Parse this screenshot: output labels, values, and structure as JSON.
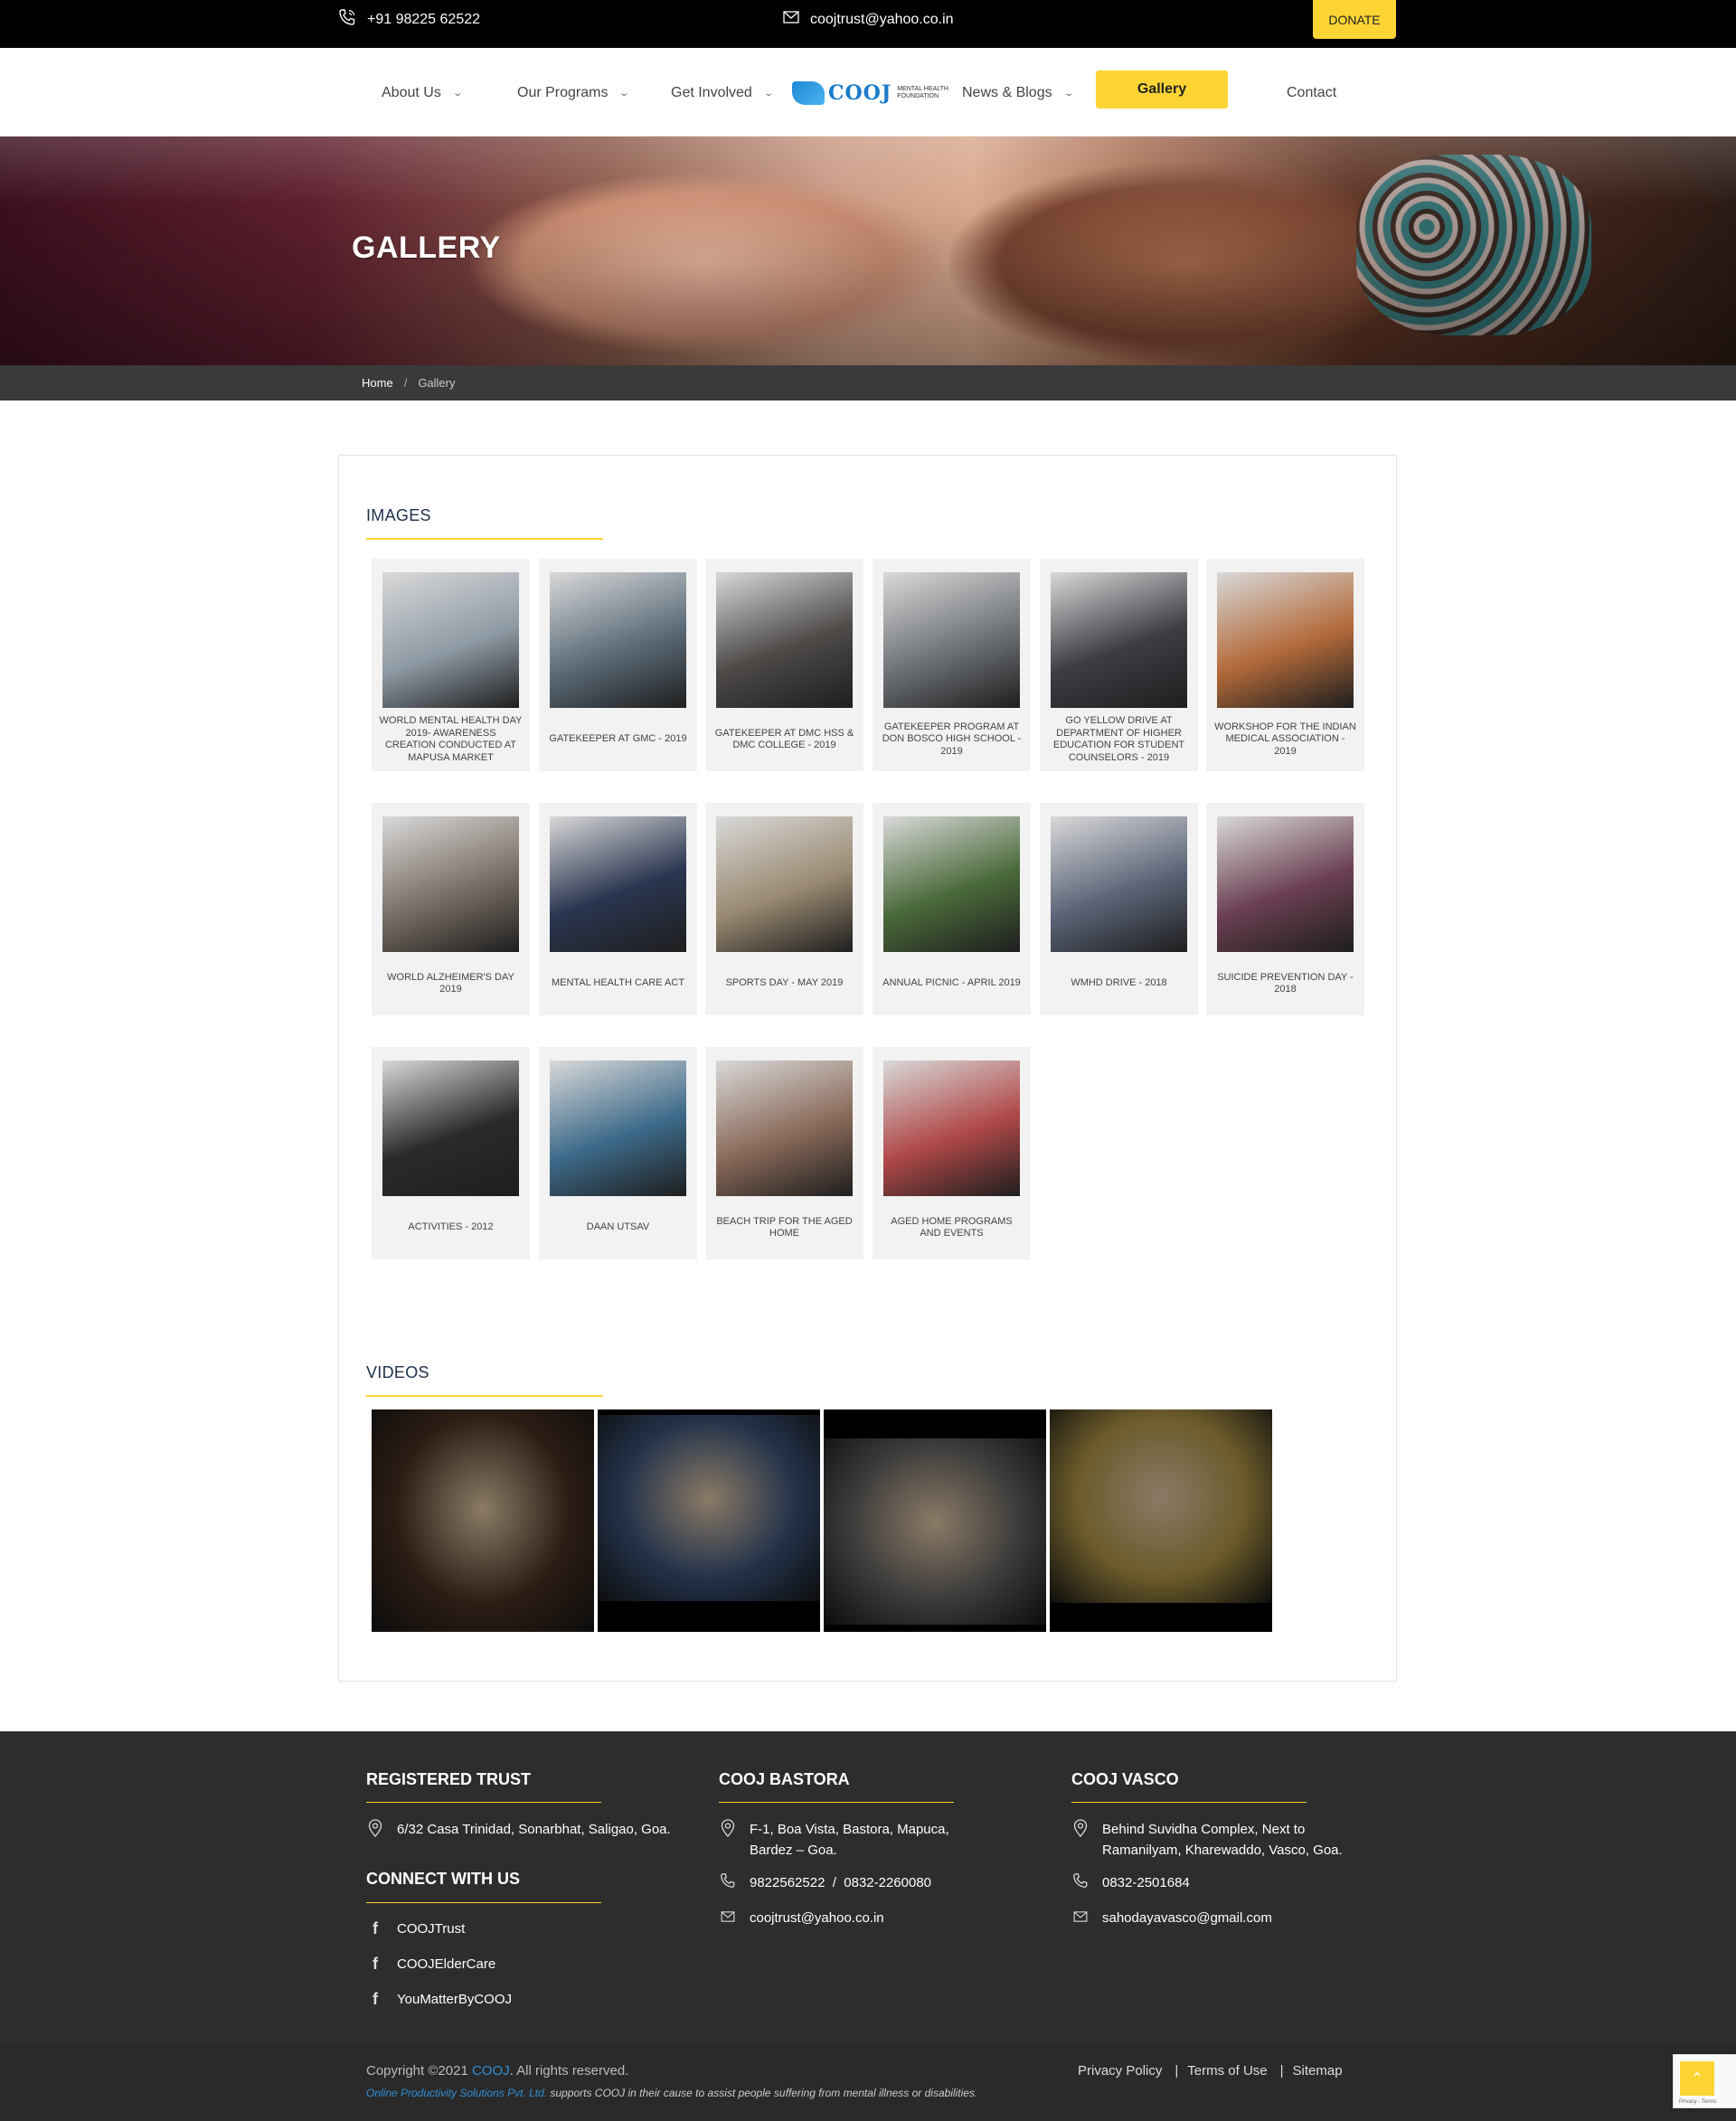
{
  "topbar": {
    "phone": "+91 98225 62522",
    "email": "coojtrust@yahoo.co.in",
    "donate": "DONATE"
  },
  "nav": {
    "items": [
      {
        "label": "About Us",
        "has_dropdown": true
      },
      {
        "label": "Our Programs",
        "has_dropdown": true
      },
      {
        "label": "Get Involved",
        "has_dropdown": true
      },
      {
        "label": "News & Blogs",
        "has_dropdown": true
      },
      {
        "label": "Gallery",
        "active": true
      },
      {
        "label": "Contact"
      }
    ],
    "logo_text": "COOJ",
    "logo_sub": "MENTAL HEALTH FOUNDATION"
  },
  "hero": {
    "title": "GALLERY"
  },
  "breadcrumb": {
    "home": "Home",
    "current": "Gallery"
  },
  "images_section": {
    "title": "IMAGES",
    "items": [
      {
        "caption": "WORLD MENTAL HEALTH DAY 2019- AWARENESS CREATION CONDUCTED AT MAPUSA MARKET",
        "tone": "#8e9aa4"
      },
      {
        "caption": "GATEKEEPER AT GMC - 2019",
        "tone": "#5d6d7a"
      },
      {
        "caption": "GATEKEEPER AT DMC HSS & DMC COLLEGE - 2019",
        "tone": "#4d4a48"
      },
      {
        "caption": "GATEKEEPER PROGRAM AT DON BOSCO HIGH SCHOOL - 2019",
        "tone": "#6f7378"
      },
      {
        "caption": "GO YELLOW DRIVE AT DEPARTMENT OF HIGHER EDUCATION FOR STUDENT COUNSELORS - 2019",
        "tone": "#3f3c44"
      },
      {
        "caption": "WORKSHOP FOR THE INDIAN MEDICAL ASSOCIATION - 2019",
        "tone": "#b36a3a"
      },
      {
        "caption": "WORLD ALZHEIMER'S DAY 2019",
        "tone": "#7a6f66"
      },
      {
        "caption": "MENTAL HEALTH CARE ACT",
        "tone": "#2a3550"
      },
      {
        "caption": "SPORTS DAY - MAY 2019",
        "tone": "#9a8a72"
      },
      {
        "caption": "ANNUAL PICNIC - APRIL 2019",
        "tone": "#4a6a3a"
      },
      {
        "caption": "WMHD DRIVE - 2018",
        "tone": "#5b6478"
      },
      {
        "caption": "SUICIDE PREVENTION DAY - 2018",
        "tone": "#6b3f52"
      },
      {
        "caption": "ACTIVITIES - 2012",
        "tone": "#2a2a2a"
      },
      {
        "caption": "DAAN UTSAV",
        "tone": "#3d6a8a"
      },
      {
        "caption": "BEACH TRIP FOR THE AGED HOME",
        "tone": "#8a6a5a"
      },
      {
        "caption": "AGED HOME PROGRAMS AND EVENTS",
        "tone": "#b04848"
      }
    ]
  },
  "videos_section": {
    "title": "VIDEOS",
    "items": [
      {
        "tone": "#2b1d14"
      },
      {
        "tone": "#23324a"
      },
      {
        "tone": "#3a3a3a"
      },
      {
        "tone": "#6a5a2a"
      }
    ]
  },
  "footer": {
    "trust": {
      "title": "REGISTERED TRUST",
      "address": "6/32 Casa Trinidad, Sonarbhat, Saligao, Goa."
    },
    "connect": {
      "title": "CONNECT WITH US",
      "links": [
        "COOJTrust",
        "COOJElderCare",
        "YouMatterByCOOJ"
      ]
    },
    "bastora": {
      "title": "COOJ BASTORA",
      "address_line1": "F-1, Boa Vista, Bastora, Mapuca,",
      "address_line2": "Bardez – Goa.",
      "phone": "9822562522  /  0832-2260080",
      "email": "coojtrust@yahoo.co.in"
    },
    "vasco": {
      "title": "COOJ VASCO",
      "address_line1": "Behind Suvidha Complex, Next to",
      "address_line2": "Ramanilyam, Kharewaddo, Vasco, Goa.",
      "phone": "0832-2501684",
      "email": "sahodayavasco@gmail.com"
    },
    "copyright_prefix": "Copyright ©2021 ",
    "copyright_brand": "COOJ",
    "copyright_suffix": ". All rights reserved.",
    "credit_link": "Online Productivity Solutions Pvt. Ltd.",
    "credit_text": " supports COOJ in their cause to assist people suffering from mental illness or disabilities.",
    "links": [
      "Privacy Policy",
      "Terms of Use",
      "Sitemap"
    ]
  },
  "recaptcha_text": "Privacy - Terms"
}
